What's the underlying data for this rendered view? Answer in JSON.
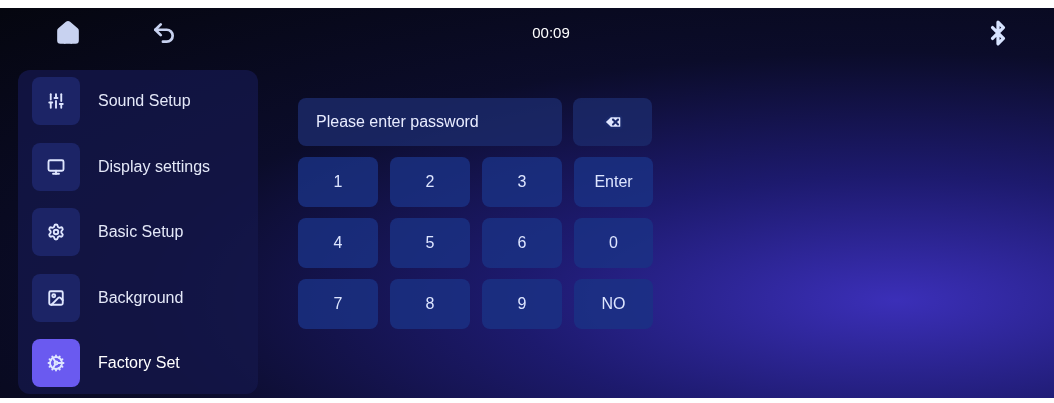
{
  "status_bar": {
    "time": "00:09"
  },
  "sidebar": {
    "items": [
      {
        "label": "Sound Setup",
        "selected": false
      },
      {
        "label": "Display settings",
        "selected": false
      },
      {
        "label": "Basic Setup",
        "selected": false
      },
      {
        "label": "Background",
        "selected": false
      },
      {
        "label": "Factory Set",
        "selected": true
      }
    ]
  },
  "password": {
    "placeholder": "Please enter password"
  },
  "keypad": {
    "keys": [
      {
        "label": "1"
      },
      {
        "label": "2"
      },
      {
        "label": "3"
      },
      {
        "label": "Enter"
      },
      {
        "label": "4"
      },
      {
        "label": "5"
      },
      {
        "label": "6"
      },
      {
        "label": "0"
      },
      {
        "label": "7"
      },
      {
        "label": "8"
      },
      {
        "label": "9"
      },
      {
        "label": "NO"
      }
    ]
  }
}
